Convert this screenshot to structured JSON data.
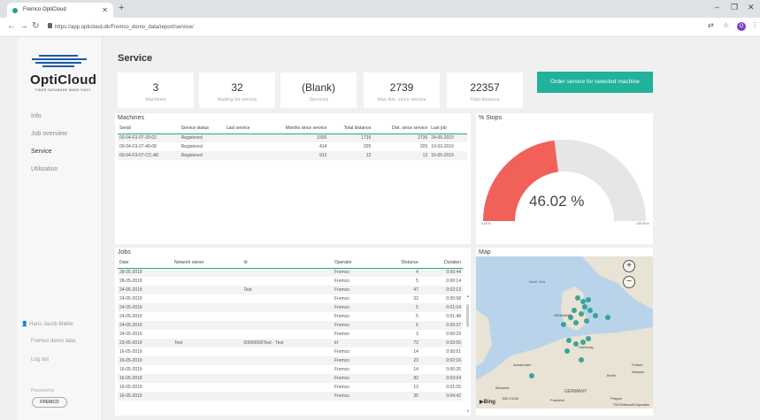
{
  "browser": {
    "tab_title": "Fremco OptiCloud",
    "url": "https://app.opticloud.dk/Fremco_demo_data/report/service/",
    "avatar_letter": "O"
  },
  "sidebar": {
    "logo_text": "OptiCloud",
    "logo_sub": "FIBER DATABASE MADE EASY",
    "items": [
      {
        "label": "Info"
      },
      {
        "label": "Job overview"
      },
      {
        "label": "Service"
      },
      {
        "label": "Utilization"
      }
    ],
    "user": "Hans Jacob Møller",
    "org": "Fremco demo data",
    "logout": "Log out",
    "powered_by": "Powered by",
    "brand": "FREMCO"
  },
  "page": {
    "title": "Service",
    "order_button": "Order service for selected machine"
  },
  "kpis": [
    {
      "value": "3",
      "label": "Machines"
    },
    {
      "value": "32",
      "label": "Waiting for service"
    },
    {
      "value": "(Blank)",
      "label": "Serviced"
    },
    {
      "value": "2739",
      "label": "Max dist. since service"
    },
    {
      "value": "22357",
      "label": "Total distance"
    }
  ],
  "machines": {
    "title": "Machines",
    "columns": [
      "Serial",
      "Service status",
      "Last service",
      "Months since service",
      "Total distance",
      "Dist. since service",
      "Last job"
    ],
    "rows": [
      [
        "00-04-F3-07-39-02",
        "Registered",
        "",
        "1500",
        "1739",
        "2736",
        "24-05-2019"
      ],
      [
        "00-04-F3-07-48-08",
        "Registered",
        "",
        "414",
        "205",
        "205",
        "19-03-2019"
      ],
      [
        "00-04-F3-07-CC-A6",
        "Registered",
        "",
        "912",
        "12",
        "12",
        "16-05-2019"
      ]
    ]
  },
  "stops": {
    "title": "% Stops",
    "value_text": "46.02 %",
    "value": 46.02,
    "min_label": "0.00 %",
    "max_label": "100.00 %",
    "fill_color": "#f2605a",
    "track_color": "#e6e6e6"
  },
  "jobs": {
    "title": "Jobs",
    "columns": [
      "Date",
      "Network owner",
      "Id",
      "Operator",
      "Distance",
      "Duration"
    ],
    "rows": [
      [
        "28-05-2019",
        "",
        "",
        "Fremco",
        "4",
        "0:00:44"
      ],
      [
        "28-05-2019",
        "",
        "",
        "Fremco",
        "5",
        "0:00:14"
      ],
      [
        "24-05-2019",
        "",
        "Test",
        "Fremco",
        "47",
        "0:02:13"
      ],
      [
        "24-05-2019",
        "",
        "",
        "Fremco",
        "32",
        "0:00:58"
      ],
      [
        "24-05-2019",
        "",
        "",
        "Fremco",
        "5",
        "0:01:04"
      ],
      [
        "24-05-2019",
        "",
        "",
        "Fremco",
        "5",
        "0:01:48"
      ],
      [
        "24-05-2019",
        "",
        "",
        "Fremco",
        "6",
        "0:00:37"
      ],
      [
        "24-05-2019",
        "",
        "",
        "Fremco",
        "3",
        "0:00:29"
      ],
      [
        "23-05-2019",
        "Test",
        "00000000Test - Test",
        "kf",
        "72",
        "0:03:55"
      ],
      [
        "16-05-2019",
        "",
        "",
        "Fremco",
        "14",
        "0:00:51"
      ],
      [
        "16-05-2019",
        "",
        "",
        "Fremco",
        "23",
        "0:02:16"
      ],
      [
        "16-05-2019",
        "",
        "",
        "Fremco",
        "14",
        "0:00:35"
      ],
      [
        "16-05-2019",
        "",
        "",
        "Fremco",
        "82",
        "0:03:04"
      ],
      [
        "16-05-2019",
        "",
        "",
        "Fremco",
        "13",
        "0:01:05"
      ],
      [
        "16-05-2019",
        "",
        "",
        "Fremco",
        "35",
        "0:04:42"
      ]
    ]
  },
  "map": {
    "title": "Map",
    "labels": [
      "North Sea",
      "DENMARK",
      "Hamburg",
      "Amsterdam",
      "Berlin",
      "GERMANY",
      "Warsaw",
      "Poland",
      "BELGIUM",
      "Frankfurt",
      "Prague",
      "Brussels"
    ],
    "bing": "Bing",
    "copyright": "©2019 Microsoft Corporation",
    "marker_color": "#2a9d8f"
  }
}
